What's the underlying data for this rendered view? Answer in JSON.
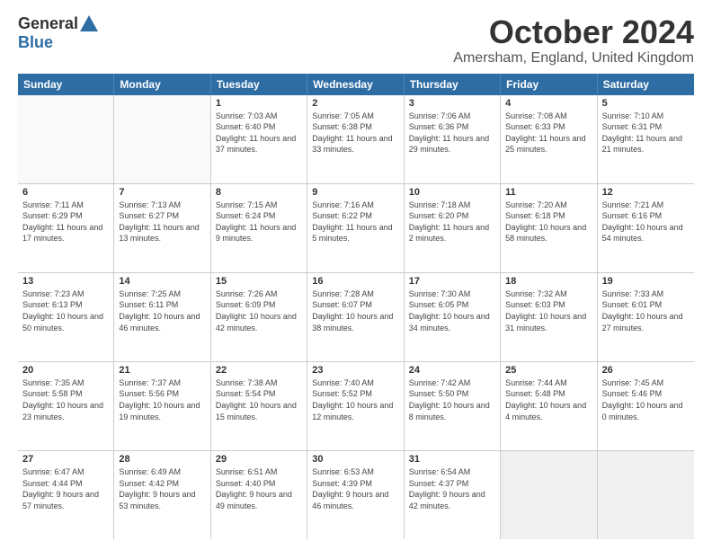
{
  "logo": {
    "general": "General",
    "blue": "Blue"
  },
  "title": "October 2024",
  "location": "Amersham, England, United Kingdom",
  "days_of_week": [
    "Sunday",
    "Monday",
    "Tuesday",
    "Wednesday",
    "Thursday",
    "Friday",
    "Saturday"
  ],
  "weeks": [
    [
      {
        "day": "",
        "info": "",
        "empty": true
      },
      {
        "day": "",
        "info": "",
        "empty": true
      },
      {
        "day": "1",
        "info": "Sunrise: 7:03 AM\nSunset: 6:40 PM\nDaylight: 11 hours and 37 minutes."
      },
      {
        "day": "2",
        "info": "Sunrise: 7:05 AM\nSunset: 6:38 PM\nDaylight: 11 hours and 33 minutes."
      },
      {
        "day": "3",
        "info": "Sunrise: 7:06 AM\nSunset: 6:36 PM\nDaylight: 11 hours and 29 minutes."
      },
      {
        "day": "4",
        "info": "Sunrise: 7:08 AM\nSunset: 6:33 PM\nDaylight: 11 hours and 25 minutes."
      },
      {
        "day": "5",
        "info": "Sunrise: 7:10 AM\nSunset: 6:31 PM\nDaylight: 11 hours and 21 minutes."
      }
    ],
    [
      {
        "day": "6",
        "info": "Sunrise: 7:11 AM\nSunset: 6:29 PM\nDaylight: 11 hours and 17 minutes."
      },
      {
        "day": "7",
        "info": "Sunrise: 7:13 AM\nSunset: 6:27 PM\nDaylight: 11 hours and 13 minutes."
      },
      {
        "day": "8",
        "info": "Sunrise: 7:15 AM\nSunset: 6:24 PM\nDaylight: 11 hours and 9 minutes."
      },
      {
        "day": "9",
        "info": "Sunrise: 7:16 AM\nSunset: 6:22 PM\nDaylight: 11 hours and 5 minutes."
      },
      {
        "day": "10",
        "info": "Sunrise: 7:18 AM\nSunset: 6:20 PM\nDaylight: 11 hours and 2 minutes."
      },
      {
        "day": "11",
        "info": "Sunrise: 7:20 AM\nSunset: 6:18 PM\nDaylight: 10 hours and 58 minutes."
      },
      {
        "day": "12",
        "info": "Sunrise: 7:21 AM\nSunset: 6:16 PM\nDaylight: 10 hours and 54 minutes."
      }
    ],
    [
      {
        "day": "13",
        "info": "Sunrise: 7:23 AM\nSunset: 6:13 PM\nDaylight: 10 hours and 50 minutes."
      },
      {
        "day": "14",
        "info": "Sunrise: 7:25 AM\nSunset: 6:11 PM\nDaylight: 10 hours and 46 minutes."
      },
      {
        "day": "15",
        "info": "Sunrise: 7:26 AM\nSunset: 6:09 PM\nDaylight: 10 hours and 42 minutes."
      },
      {
        "day": "16",
        "info": "Sunrise: 7:28 AM\nSunset: 6:07 PM\nDaylight: 10 hours and 38 minutes."
      },
      {
        "day": "17",
        "info": "Sunrise: 7:30 AM\nSunset: 6:05 PM\nDaylight: 10 hours and 34 minutes."
      },
      {
        "day": "18",
        "info": "Sunrise: 7:32 AM\nSunset: 6:03 PM\nDaylight: 10 hours and 31 minutes."
      },
      {
        "day": "19",
        "info": "Sunrise: 7:33 AM\nSunset: 6:01 PM\nDaylight: 10 hours and 27 minutes."
      }
    ],
    [
      {
        "day": "20",
        "info": "Sunrise: 7:35 AM\nSunset: 5:58 PM\nDaylight: 10 hours and 23 minutes."
      },
      {
        "day": "21",
        "info": "Sunrise: 7:37 AM\nSunset: 5:56 PM\nDaylight: 10 hours and 19 minutes."
      },
      {
        "day": "22",
        "info": "Sunrise: 7:38 AM\nSunset: 5:54 PM\nDaylight: 10 hours and 15 minutes."
      },
      {
        "day": "23",
        "info": "Sunrise: 7:40 AM\nSunset: 5:52 PM\nDaylight: 10 hours and 12 minutes."
      },
      {
        "day": "24",
        "info": "Sunrise: 7:42 AM\nSunset: 5:50 PM\nDaylight: 10 hours and 8 minutes."
      },
      {
        "day": "25",
        "info": "Sunrise: 7:44 AM\nSunset: 5:48 PM\nDaylight: 10 hours and 4 minutes."
      },
      {
        "day": "26",
        "info": "Sunrise: 7:45 AM\nSunset: 5:46 PM\nDaylight: 10 hours and 0 minutes."
      }
    ],
    [
      {
        "day": "27",
        "info": "Sunrise: 6:47 AM\nSunset: 4:44 PM\nDaylight: 9 hours and 57 minutes."
      },
      {
        "day": "28",
        "info": "Sunrise: 6:49 AM\nSunset: 4:42 PM\nDaylight: 9 hours and 53 minutes."
      },
      {
        "day": "29",
        "info": "Sunrise: 6:51 AM\nSunset: 4:40 PM\nDaylight: 9 hours and 49 minutes."
      },
      {
        "day": "30",
        "info": "Sunrise: 6:53 AM\nSunset: 4:39 PM\nDaylight: 9 hours and 46 minutes."
      },
      {
        "day": "31",
        "info": "Sunrise: 6:54 AM\nSunset: 4:37 PM\nDaylight: 9 hours and 42 minutes."
      },
      {
        "day": "",
        "info": "",
        "empty": true
      },
      {
        "day": "",
        "info": "",
        "empty": true
      }
    ]
  ]
}
